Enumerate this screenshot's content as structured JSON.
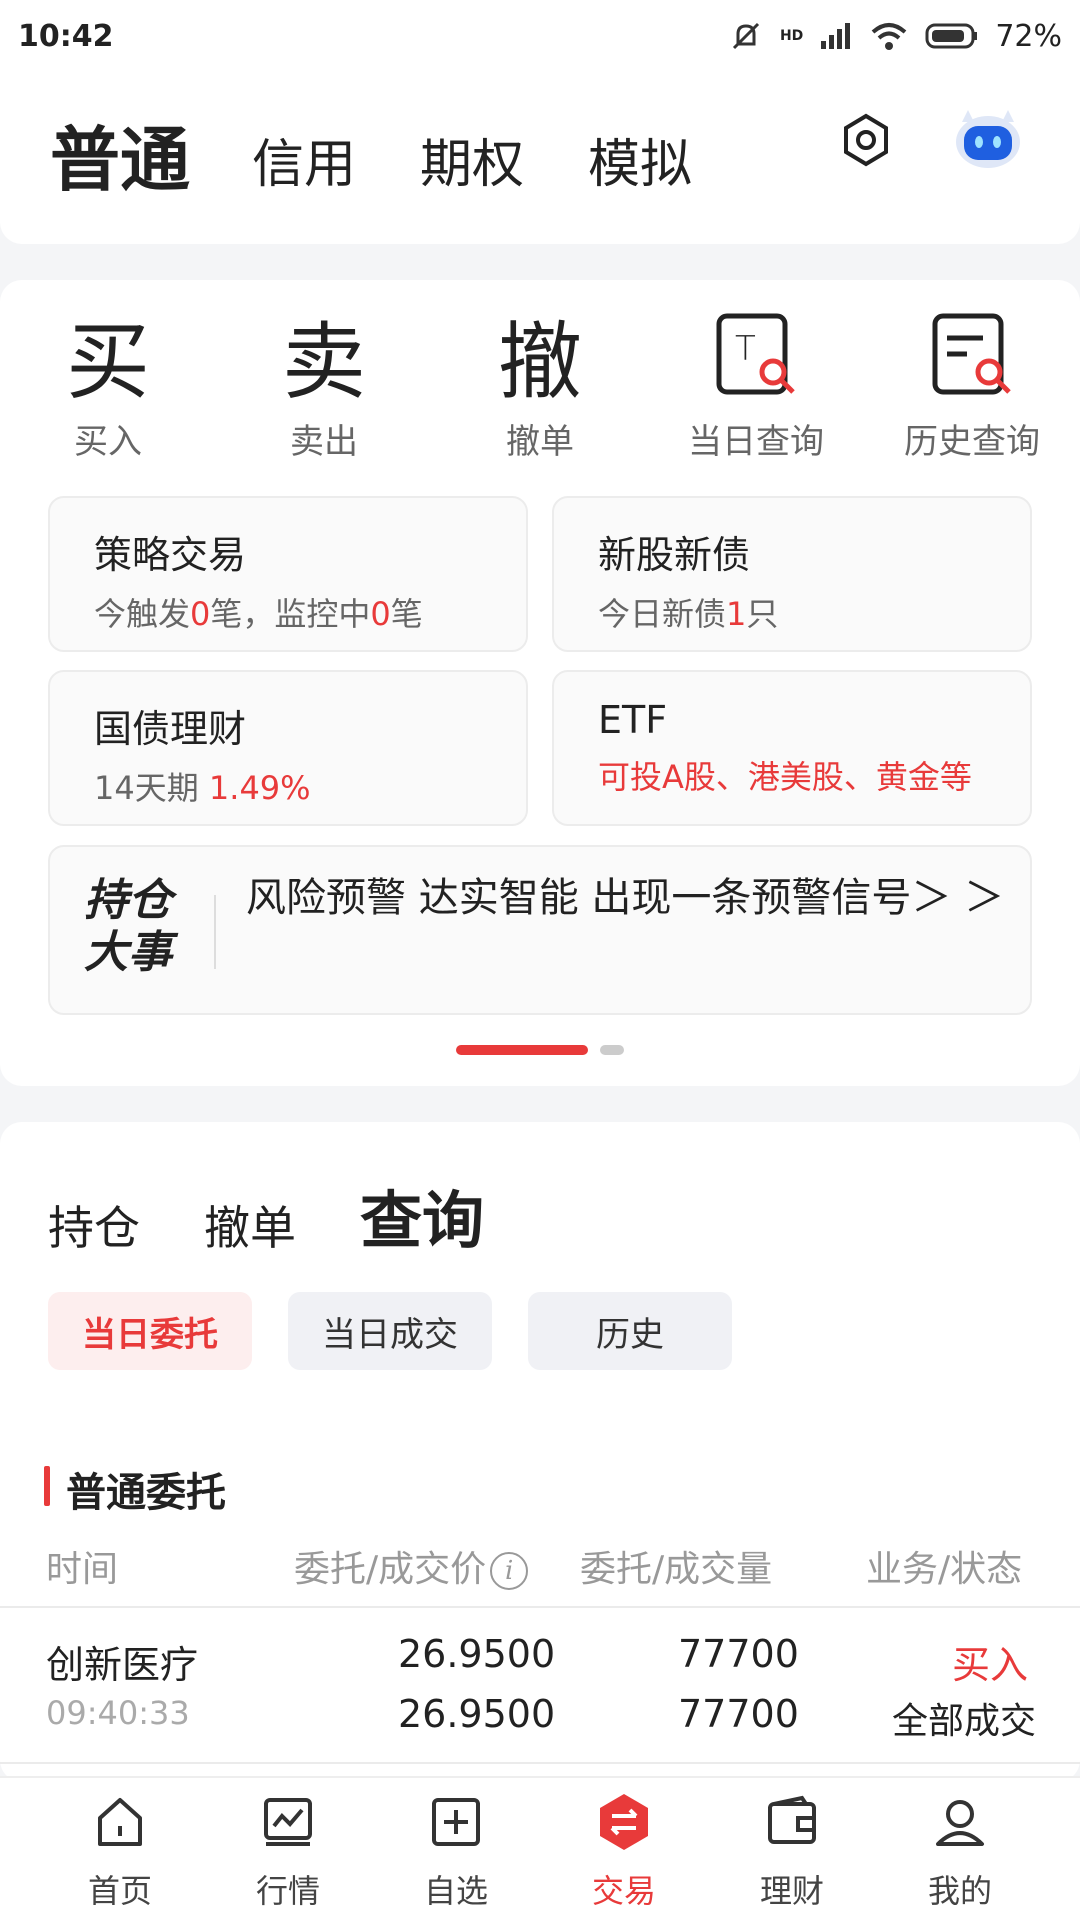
{
  "status": {
    "time": "10:42",
    "battery": "72%",
    "network": "HD"
  },
  "top_tabs": [
    {
      "label": "普通",
      "active": true
    },
    {
      "label": "信用",
      "active": false
    },
    {
      "label": "期权",
      "active": false
    },
    {
      "label": "模拟",
      "active": false
    }
  ],
  "actions": [
    {
      "label": "买入",
      "glyph": "买"
    },
    {
      "label": "卖出",
      "glyph": "卖"
    },
    {
      "label": "撤单",
      "glyph": "撤"
    },
    {
      "label": "当日查询"
    },
    {
      "label": "历史查询"
    }
  ],
  "tiles": {
    "strategy": {
      "title": "策略交易",
      "sub_a": "今触发",
      "count_a": "0",
      "sub_b": "笔，监控中",
      "count_b": "0",
      "sub_c": "笔"
    },
    "ipo": {
      "title": "新股新债",
      "sub_a": "今日新债",
      "count": "1",
      "sub_b": "只"
    },
    "bond": {
      "title": "国债理财",
      "term": "14天期",
      "rate": "1.49%"
    },
    "etf": {
      "title": "ETF",
      "desc": "可投A股、港美股、黄金等"
    }
  },
  "alert": {
    "logo_line1": "持仓",
    "logo_line2": "大事",
    "text": "风险预警 达实智能 出现一条预警信号＞ ＞"
  },
  "sub_tabs": [
    {
      "label": "持仓",
      "active": false
    },
    {
      "label": "撤单",
      "active": false
    },
    {
      "label": "查询",
      "active": true
    }
  ],
  "chips": [
    {
      "label": "当日委托",
      "active": true
    },
    {
      "label": "当日成交",
      "active": false
    },
    {
      "label": "历史",
      "active": false
    }
  ],
  "section": {
    "title": "普通委托"
  },
  "columns": {
    "time": "时间",
    "price": "委托/成交价",
    "qty": "委托/成交量",
    "status": "业务/状态"
  },
  "orders": [
    {
      "name": "创新医疗",
      "time": "09:40:33",
      "order_price": "26.9500",
      "deal_price": "26.9500",
      "order_qty": "77700",
      "deal_qty": "77700",
      "side": "买入",
      "state": "全部成交"
    }
  ],
  "nav": [
    {
      "label": "首页",
      "icon": "home-icon",
      "active": false
    },
    {
      "label": "行情",
      "icon": "chart-icon",
      "active": false
    },
    {
      "label": "自选",
      "icon": "add-box-icon",
      "active": false
    },
    {
      "label": "交易",
      "icon": "trade-icon",
      "active": true
    },
    {
      "label": "理财",
      "icon": "wallet-icon",
      "active": false
    },
    {
      "label": "我的",
      "icon": "user-icon",
      "active": false
    }
  ],
  "colors": {
    "accent": "#e83a3a",
    "tile_bg": "#fafafa",
    "page_bg": "#f4f5f7"
  }
}
